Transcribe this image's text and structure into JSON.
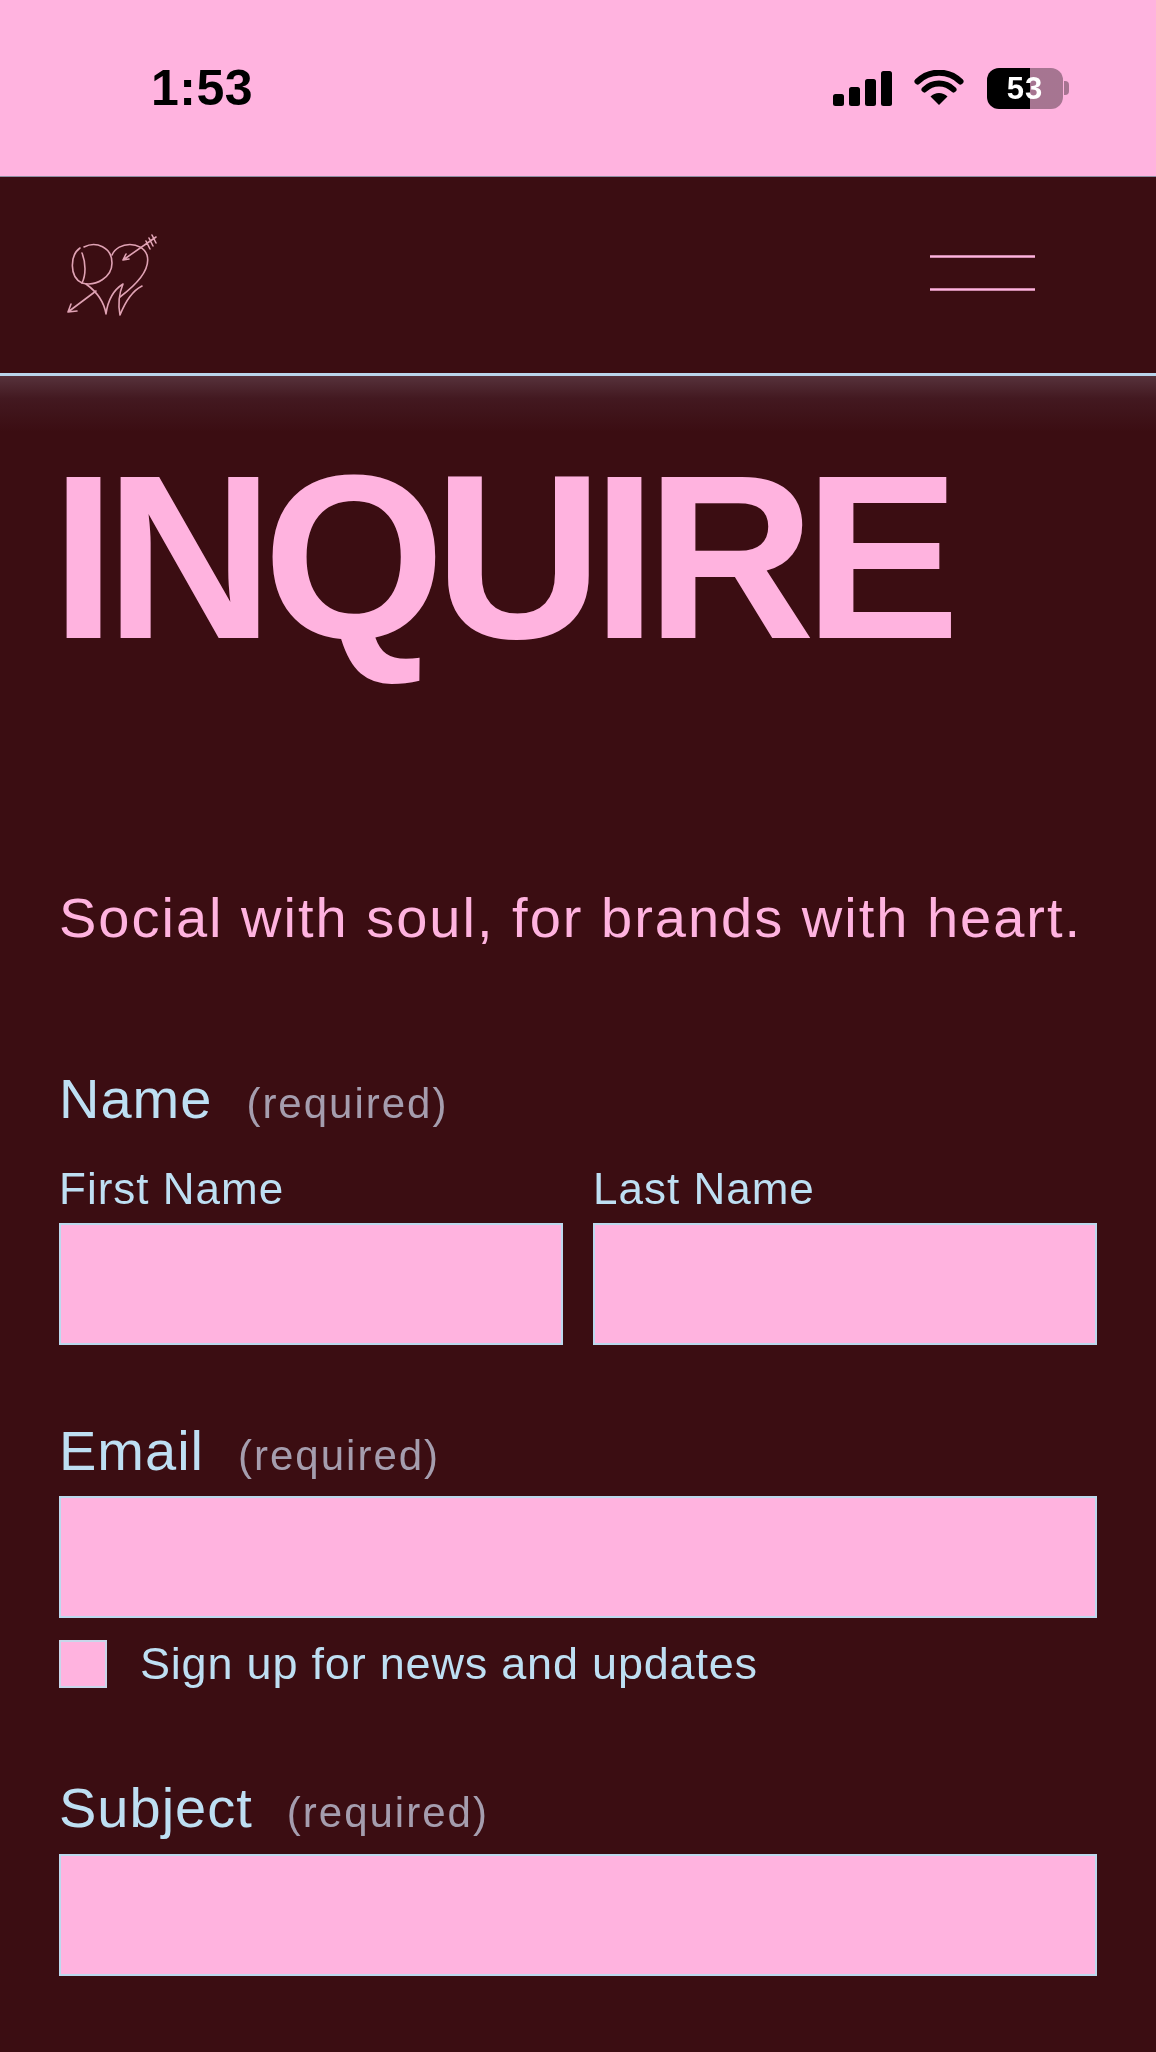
{
  "status_bar": {
    "time": "1:53",
    "battery": "53"
  },
  "title": "INQUIRE",
  "tagline": "Social with soul, for brands with heart.",
  "form": {
    "fields": [
      {
        "kind": "name",
        "label": "Name",
        "note": "(required)",
        "parts": [
          {
            "label": "First Name"
          },
          {
            "label": "Last Name"
          }
        ]
      },
      {
        "kind": "text",
        "label": "Email",
        "note": "(required)"
      },
      {
        "kind": "checkbox",
        "label": "Sign up for news and updates",
        "checked": false
      },
      {
        "kind": "text",
        "label": "Subject",
        "note": "(required)"
      }
    ]
  }
}
